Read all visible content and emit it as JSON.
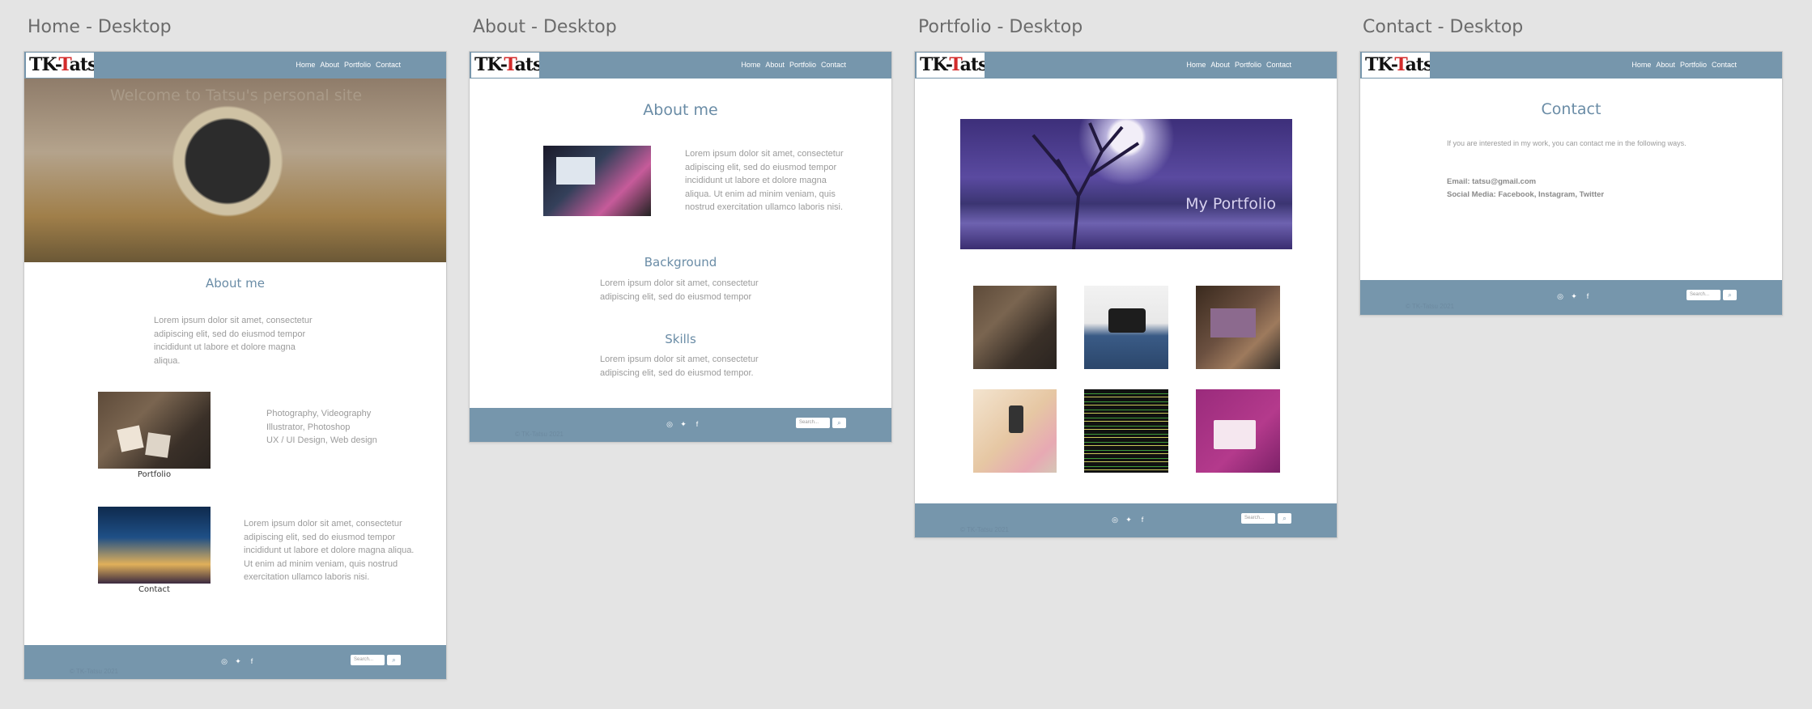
{
  "artboards": {
    "home": {
      "title": "Home - Desktop"
    },
    "about": {
      "title": "About - Desktop"
    },
    "portfolio": {
      "title": "Portfolio - Desktop"
    },
    "contact": {
      "title": "Contact - Desktop"
    }
  },
  "logo": {
    "text_black": "TK-",
    "text_red": "T",
    "text_rest": "atsu"
  },
  "nav": [
    "Home",
    "About",
    "Portfolio",
    "Contact"
  ],
  "footer": {
    "search_placeholder": "Search...",
    "copyright": "© TK-Tatsu 2021"
  },
  "home": {
    "hero_text": "Welcome to Tatsu's personal site",
    "about_heading": "About me",
    "about_text": "Lorem ipsum dolor sit amet, consectetur adipiscing elit, sed do eiusmod tempor incididunt ut labore et dolore magna aliqua.",
    "portfolio_caption": "Portfolio",
    "skills_lines": [
      "Photography, Videography",
      "Illustrator, Photoshop",
      "UX / UI Design, Web design"
    ],
    "contact_caption": "Contact",
    "contact_text": "Lorem ipsum dolor sit amet, consectetur adipiscing elit, sed do eiusmod tempor incididunt ut labore et dolore magna aliqua. Ut enim ad minim veniam, quis nostrud exercitation ullamco laboris nisi."
  },
  "about": {
    "heading": "About me",
    "intro": "Lorem ipsum dolor sit amet, consectetur adipiscing elit, sed do eiusmod tempor incididunt ut labore et dolore magna aliqua. Ut enim ad minim veniam, quis nostrud exercitation ullamco laboris nisi.",
    "background_heading": "Background",
    "background_text": "Lorem ipsum dolor sit amet, consectetur adipiscing elit, sed do eiusmod tempor",
    "skills_heading": "Skills",
    "skills_text": "Lorem ipsum dolor sit amet, consectetur adipiscing elit, sed do eiusmod tempor."
  },
  "portfolio": {
    "banner_text": "My Portfolio"
  },
  "contact": {
    "heading": "Contact",
    "intro": "If you are interested in my work, you can contact me in the following ways.",
    "email": "Email: tatsu@gmail.com",
    "social": "Social Media: Facebook, Instagram, Twitter"
  },
  "colors": {
    "nav_bg": "#7696ac",
    "heading": "#6a8ca6",
    "logo_red": "#d32b2b"
  }
}
